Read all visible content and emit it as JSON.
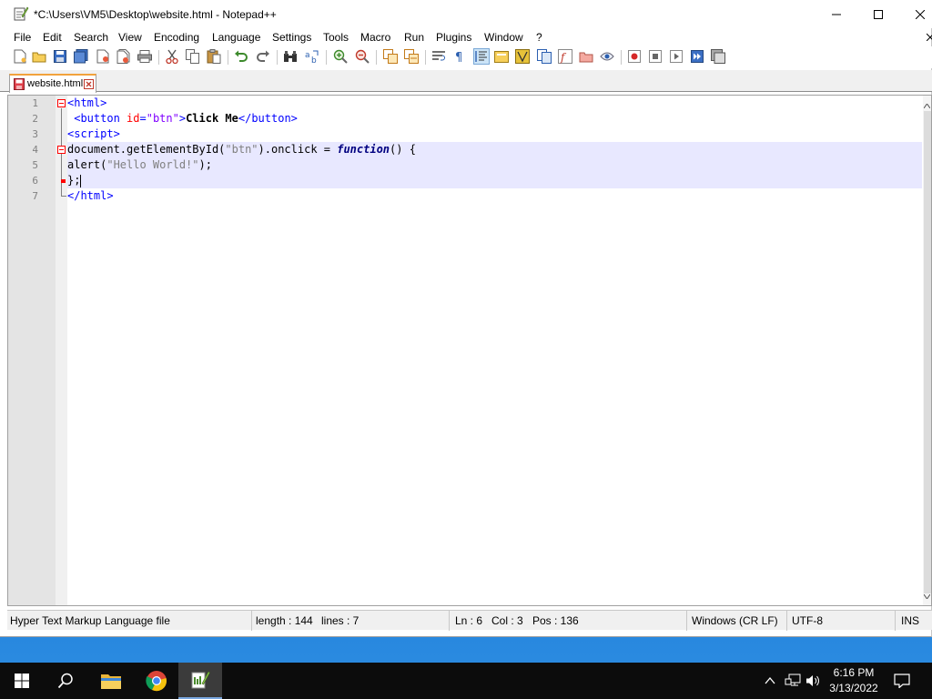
{
  "window": {
    "title": "*C:\\Users\\VM5\\Desktop\\website.html - Notepad++"
  },
  "menu": [
    "File",
    "Edit",
    "Search",
    "View",
    "Encoding",
    "Language",
    "Settings",
    "Tools",
    "Macro",
    "Run",
    "Plugins",
    "Window",
    "?"
  ],
  "tab": {
    "label": "website.html"
  },
  "editor": {
    "line_numbers": [
      "1",
      "2",
      "3",
      "4",
      "5",
      "6",
      "7"
    ],
    "lines": {
      "l1_tag": "<html>",
      "l2_open": "<button ",
      "l2_attr": "id",
      "l2_eq": "=",
      "l2_val": "\"btn\"",
      "l2_close": ">",
      "l2_text": "Click Me",
      "l2_end": "</button>",
      "l3_tag": "<script>",
      "l4_a": "document.getElementById(",
      "l4_str": "\"btn\"",
      "l4_b": ").onclick = ",
      "l4_kw": "function",
      "l4_c": "() {",
      "l5_a": "alert(",
      "l5_str": "\"Hello World!\"",
      "l5_b": ");",
      "l6": "};",
      "l7_tag": "</html>"
    }
  },
  "status": {
    "file_type": "Hyper Text Markup Language file",
    "length": "length : 144",
    "lines": "lines : 7",
    "ln": "Ln : 6",
    "col": "Col : 3",
    "pos": "Pos : 136",
    "eol": "Windows (CR LF)",
    "encoding": "UTF-8",
    "mode": "INS"
  },
  "taskbar": {
    "time": "6:16 PM",
    "date": "3/13/2022"
  },
  "colors": {
    "tag": "#0000ff",
    "attr": "#ff0000",
    "string": "#8000ff",
    "current_line": "#e8e8ff",
    "tab_accent": "#f2a23c"
  }
}
